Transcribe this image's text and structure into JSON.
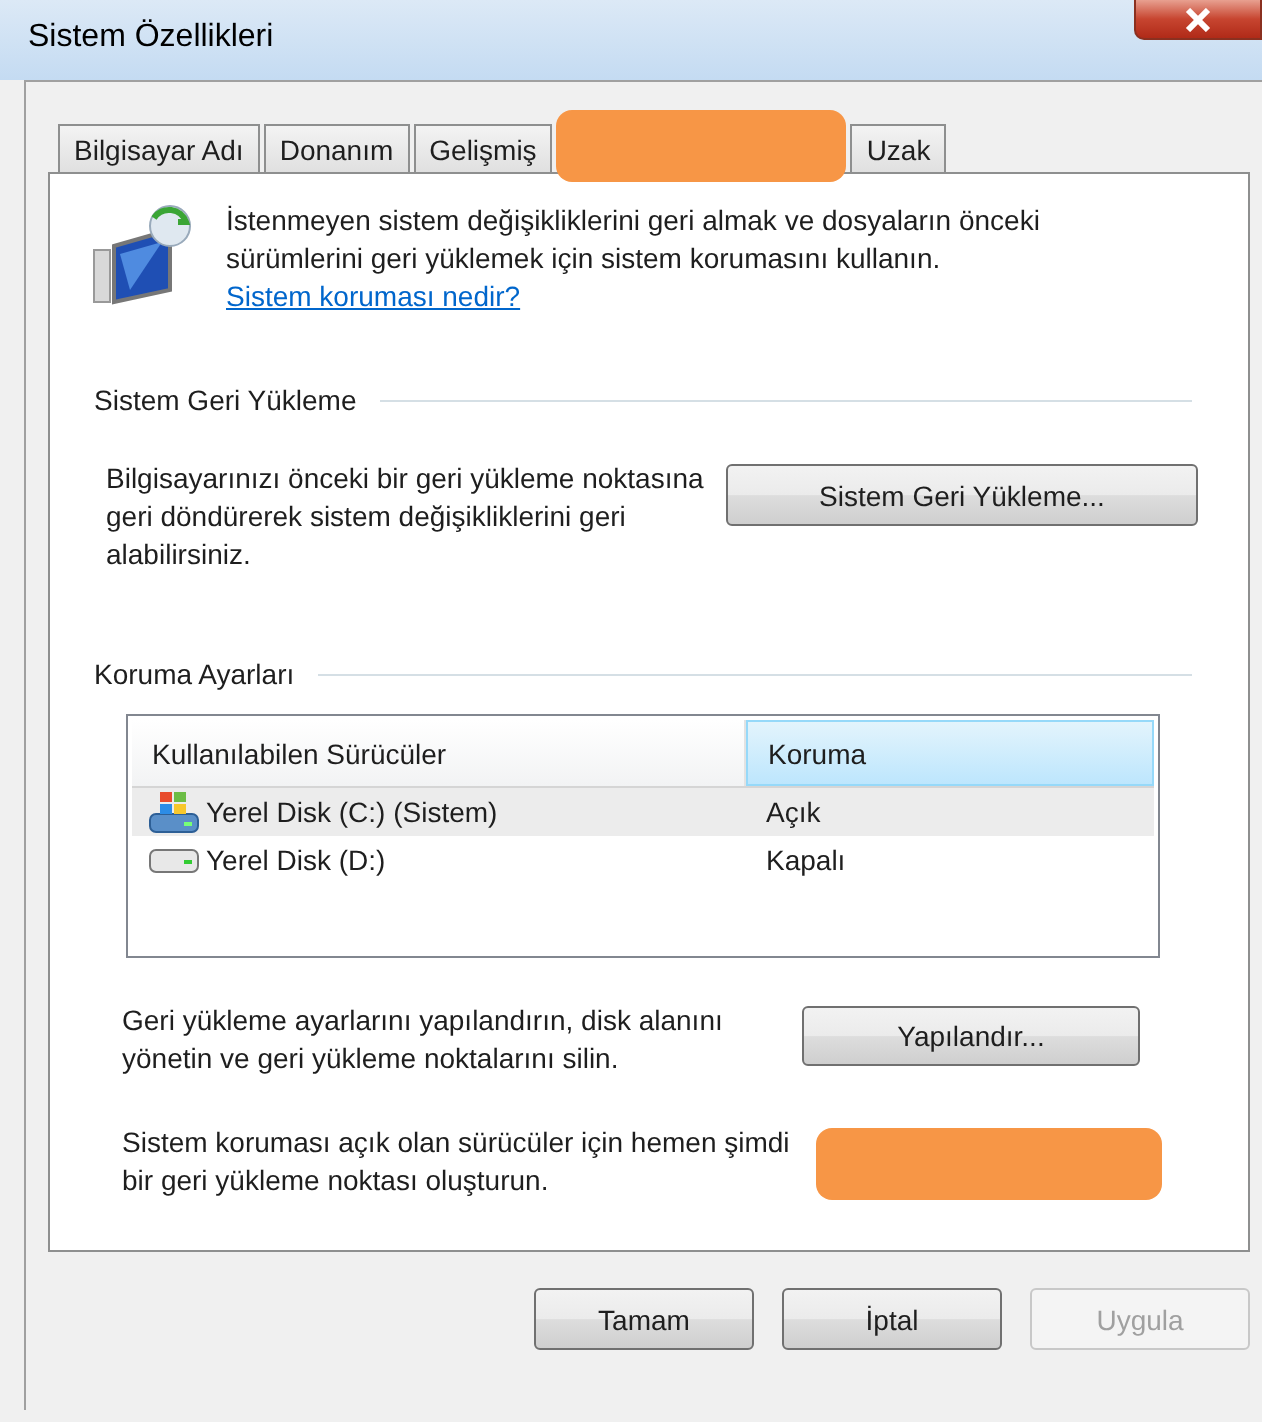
{
  "window": {
    "title": "Sistem Özellikleri"
  },
  "tabs": [
    {
      "kind": "text",
      "label": "Bilgisayar Adı",
      "selected": false
    },
    {
      "kind": "text",
      "label": "Donanım",
      "selected": false
    },
    {
      "kind": "text",
      "label": "Gelişmiş",
      "selected": false
    },
    {
      "kind": "redacted",
      "selected": true
    },
    {
      "kind": "text",
      "label": "Uzak",
      "selected": false
    }
  ],
  "intro": {
    "text": "İstenmeyen sistem değişikliklerini geri almak ve dosyaların önceki sürümlerini geri yüklemek için sistem korumasını kullanın.",
    "link": "Sistem koruması nedir?"
  },
  "restore_section": {
    "heading": "Sistem Geri Yükleme",
    "description": "Bilgisayarınızı önceki bir geri yükleme noktasına geri döndürerek sistem değişikliklerini geri alabilirsiniz.",
    "button": "Sistem Geri Yükleme..."
  },
  "protection_section": {
    "heading": "Koruma Ayarları",
    "columns": [
      {
        "label": "Kullanılabilen Sürücüler",
        "highlighted": false
      },
      {
        "label": "Koruma",
        "highlighted": true
      }
    ],
    "drives": [
      {
        "kind": "system",
        "name": "Yerel Disk (C:) (Sistem)",
        "protection": "Açık",
        "selected": true
      },
      {
        "kind": "disk",
        "name": "Yerel Disk (D:)",
        "protection": "Kapalı",
        "selected": false
      }
    ],
    "configure": {
      "description": "Geri yükleme ayarlarını yapılandırın, disk alanını yönetin ve geri yükleme noktalarını silin.",
      "button": "Yapılandır..."
    },
    "create": {
      "description": "Sistem koruması açık olan sürücüler için hemen şimdi bir geri yükleme noktası oluşturun.",
      "kind": "redacted"
    }
  },
  "buttons": [
    {
      "label": "Tamam",
      "disabled": false
    },
    {
      "label": "İptal",
      "disabled": false
    },
    {
      "label": "Uygula",
      "disabled": true
    }
  ]
}
